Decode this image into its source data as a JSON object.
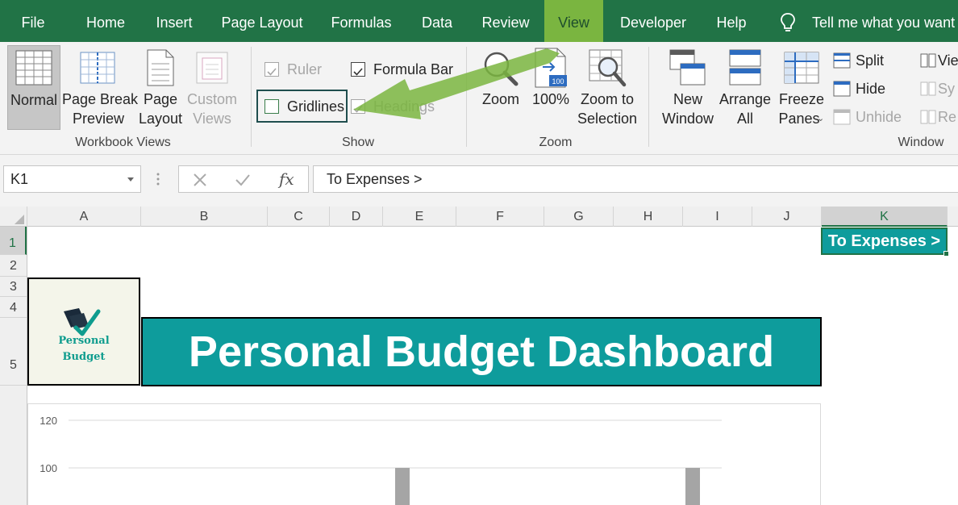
{
  "menu": {
    "tabs": [
      "File",
      "Home",
      "Insert",
      "Page Layout",
      "Formulas",
      "Data",
      "Review",
      "View",
      "Developer",
      "Help"
    ],
    "active_tab": "View",
    "tell_me": "Tell me what you want",
    "active_tab_color": "#7ab540",
    "bar_color": "#217346"
  },
  "ribbon": {
    "workbook_views": {
      "label": "Workbook Views",
      "normal": "Normal",
      "page_break_1": "Page Break",
      "page_break_2": "Preview",
      "page_layout_1": "Page",
      "page_layout_2": "Layout",
      "custom_views_1": "Custom",
      "custom_views_2": "Views"
    },
    "show": {
      "label": "Show",
      "ruler": "Ruler",
      "formula_bar": "Formula Bar",
      "gridlines": "Gridlines",
      "headings": "Headings"
    },
    "zoom": {
      "label": "Zoom",
      "zoom": "Zoom",
      "hundred": "100%",
      "hundred_icon_text": "100",
      "zoom_sel_1": "Zoom to",
      "zoom_sel_2": "Selection"
    },
    "window": {
      "label": "Window",
      "new_window_1": "New",
      "new_window_2": "Window",
      "arrange_1": "Arrange",
      "arrange_2": "All",
      "freeze_1": "Freeze",
      "freeze_2": "Panes",
      "split": "Split",
      "hide": "Hide",
      "unhide": "Unhide",
      "view_side": "Vie",
      "sync": "Sy",
      "reset": "Re"
    }
  },
  "formula_bar": {
    "name_box": "K1",
    "content": "To Expenses >",
    "fx": "fx"
  },
  "sheet": {
    "columns": [
      "A",
      "B",
      "C",
      "D",
      "E",
      "F",
      "G",
      "H",
      "I",
      "J",
      "K"
    ],
    "rows": [
      "1",
      "2",
      "3",
      "4",
      "5"
    ],
    "selected_cell": "K1",
    "link_text": "To Expenses >",
    "logo_line1": "Personal",
    "logo_line2": "Budget",
    "title": "Personal Budget Dashboard",
    "accent_color": "#0e9c9c"
  },
  "chart_data": {
    "type": "bar",
    "yticks": [
      "120",
      "100"
    ],
    "ylim": [
      0,
      120
    ],
    "categories": [
      "",
      ""
    ],
    "values": [
      100,
      100
    ]
  }
}
